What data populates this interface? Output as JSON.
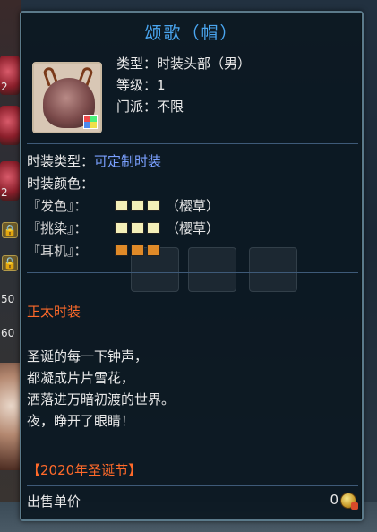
{
  "background": {
    "slot_numbers": [
      "2",
      "2",
      "50",
      "60"
    ]
  },
  "tooltip": {
    "title": "颂歌（帽）",
    "info": {
      "type_line": "类型：时装头部（男）",
      "level_line": "等级：1",
      "school_line": "门派：不限"
    },
    "fashion_type_label": "时装类型：",
    "fashion_type_value": "可定制时装",
    "fashion_color_label": "时装颜色：",
    "colors": [
      {
        "label": "『发色』：",
        "swatch": [
          "#f4efb8",
          "#f4efb8",
          "#f4efb8"
        ],
        "desc": "（樱草）"
      },
      {
        "label": "『挑染』：",
        "swatch": [
          "#f4efb8",
          "#f4efb8",
          "#f4efb8"
        ],
        "desc": "（樱草）"
      },
      {
        "label": "『耳机』：",
        "swatch": [
          "#e08a28",
          "#e08a28",
          "#e08a28"
        ],
        "desc": ""
      }
    ],
    "section_title": "正太时装",
    "poem": [
      "圣诞的每一下钟声，",
      "都凝成片片雪花，",
      "洒落进万暗初渡的世界。",
      "夜，睁开了眼睛！"
    ],
    "event_tag": "【2020年圣诞节】",
    "price_label": "出售单价",
    "price_value": "0",
    "currency_icon": "gold-coin-icon"
  }
}
